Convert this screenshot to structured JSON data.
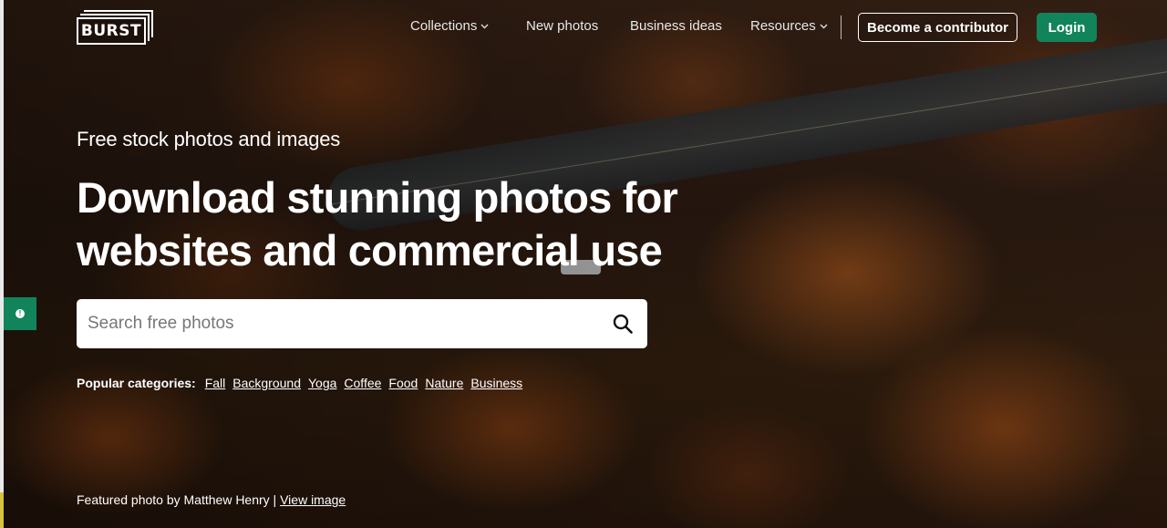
{
  "brand": {
    "logo_text": "BURST"
  },
  "nav": {
    "collections": "Collections",
    "new_photos": "New photos",
    "business_ideas": "Business ideas",
    "resources": "Resources",
    "become_contributor": "Become a contributor",
    "login": "Login"
  },
  "hero": {
    "eyebrow": "Free stock photos and images",
    "headline_line1": "Download stunning photos for",
    "headline_line2": "websites and commercial use"
  },
  "search": {
    "placeholder": "Search free photos"
  },
  "popular": {
    "label": "Popular categories:",
    "categories": [
      "Fall",
      "Background",
      "Yoga",
      "Coffee",
      "Food",
      "Nature",
      "Business"
    ]
  },
  "credit": {
    "text": "Featured photo by Matthew Henry |",
    "link": "View image"
  },
  "colors": {
    "accent_green": "#12845c",
    "text": "#ffffff"
  },
  "icons": {
    "search": "search-icon",
    "chevron": "chevron-down-icon",
    "feedback": "feedback-icon"
  }
}
